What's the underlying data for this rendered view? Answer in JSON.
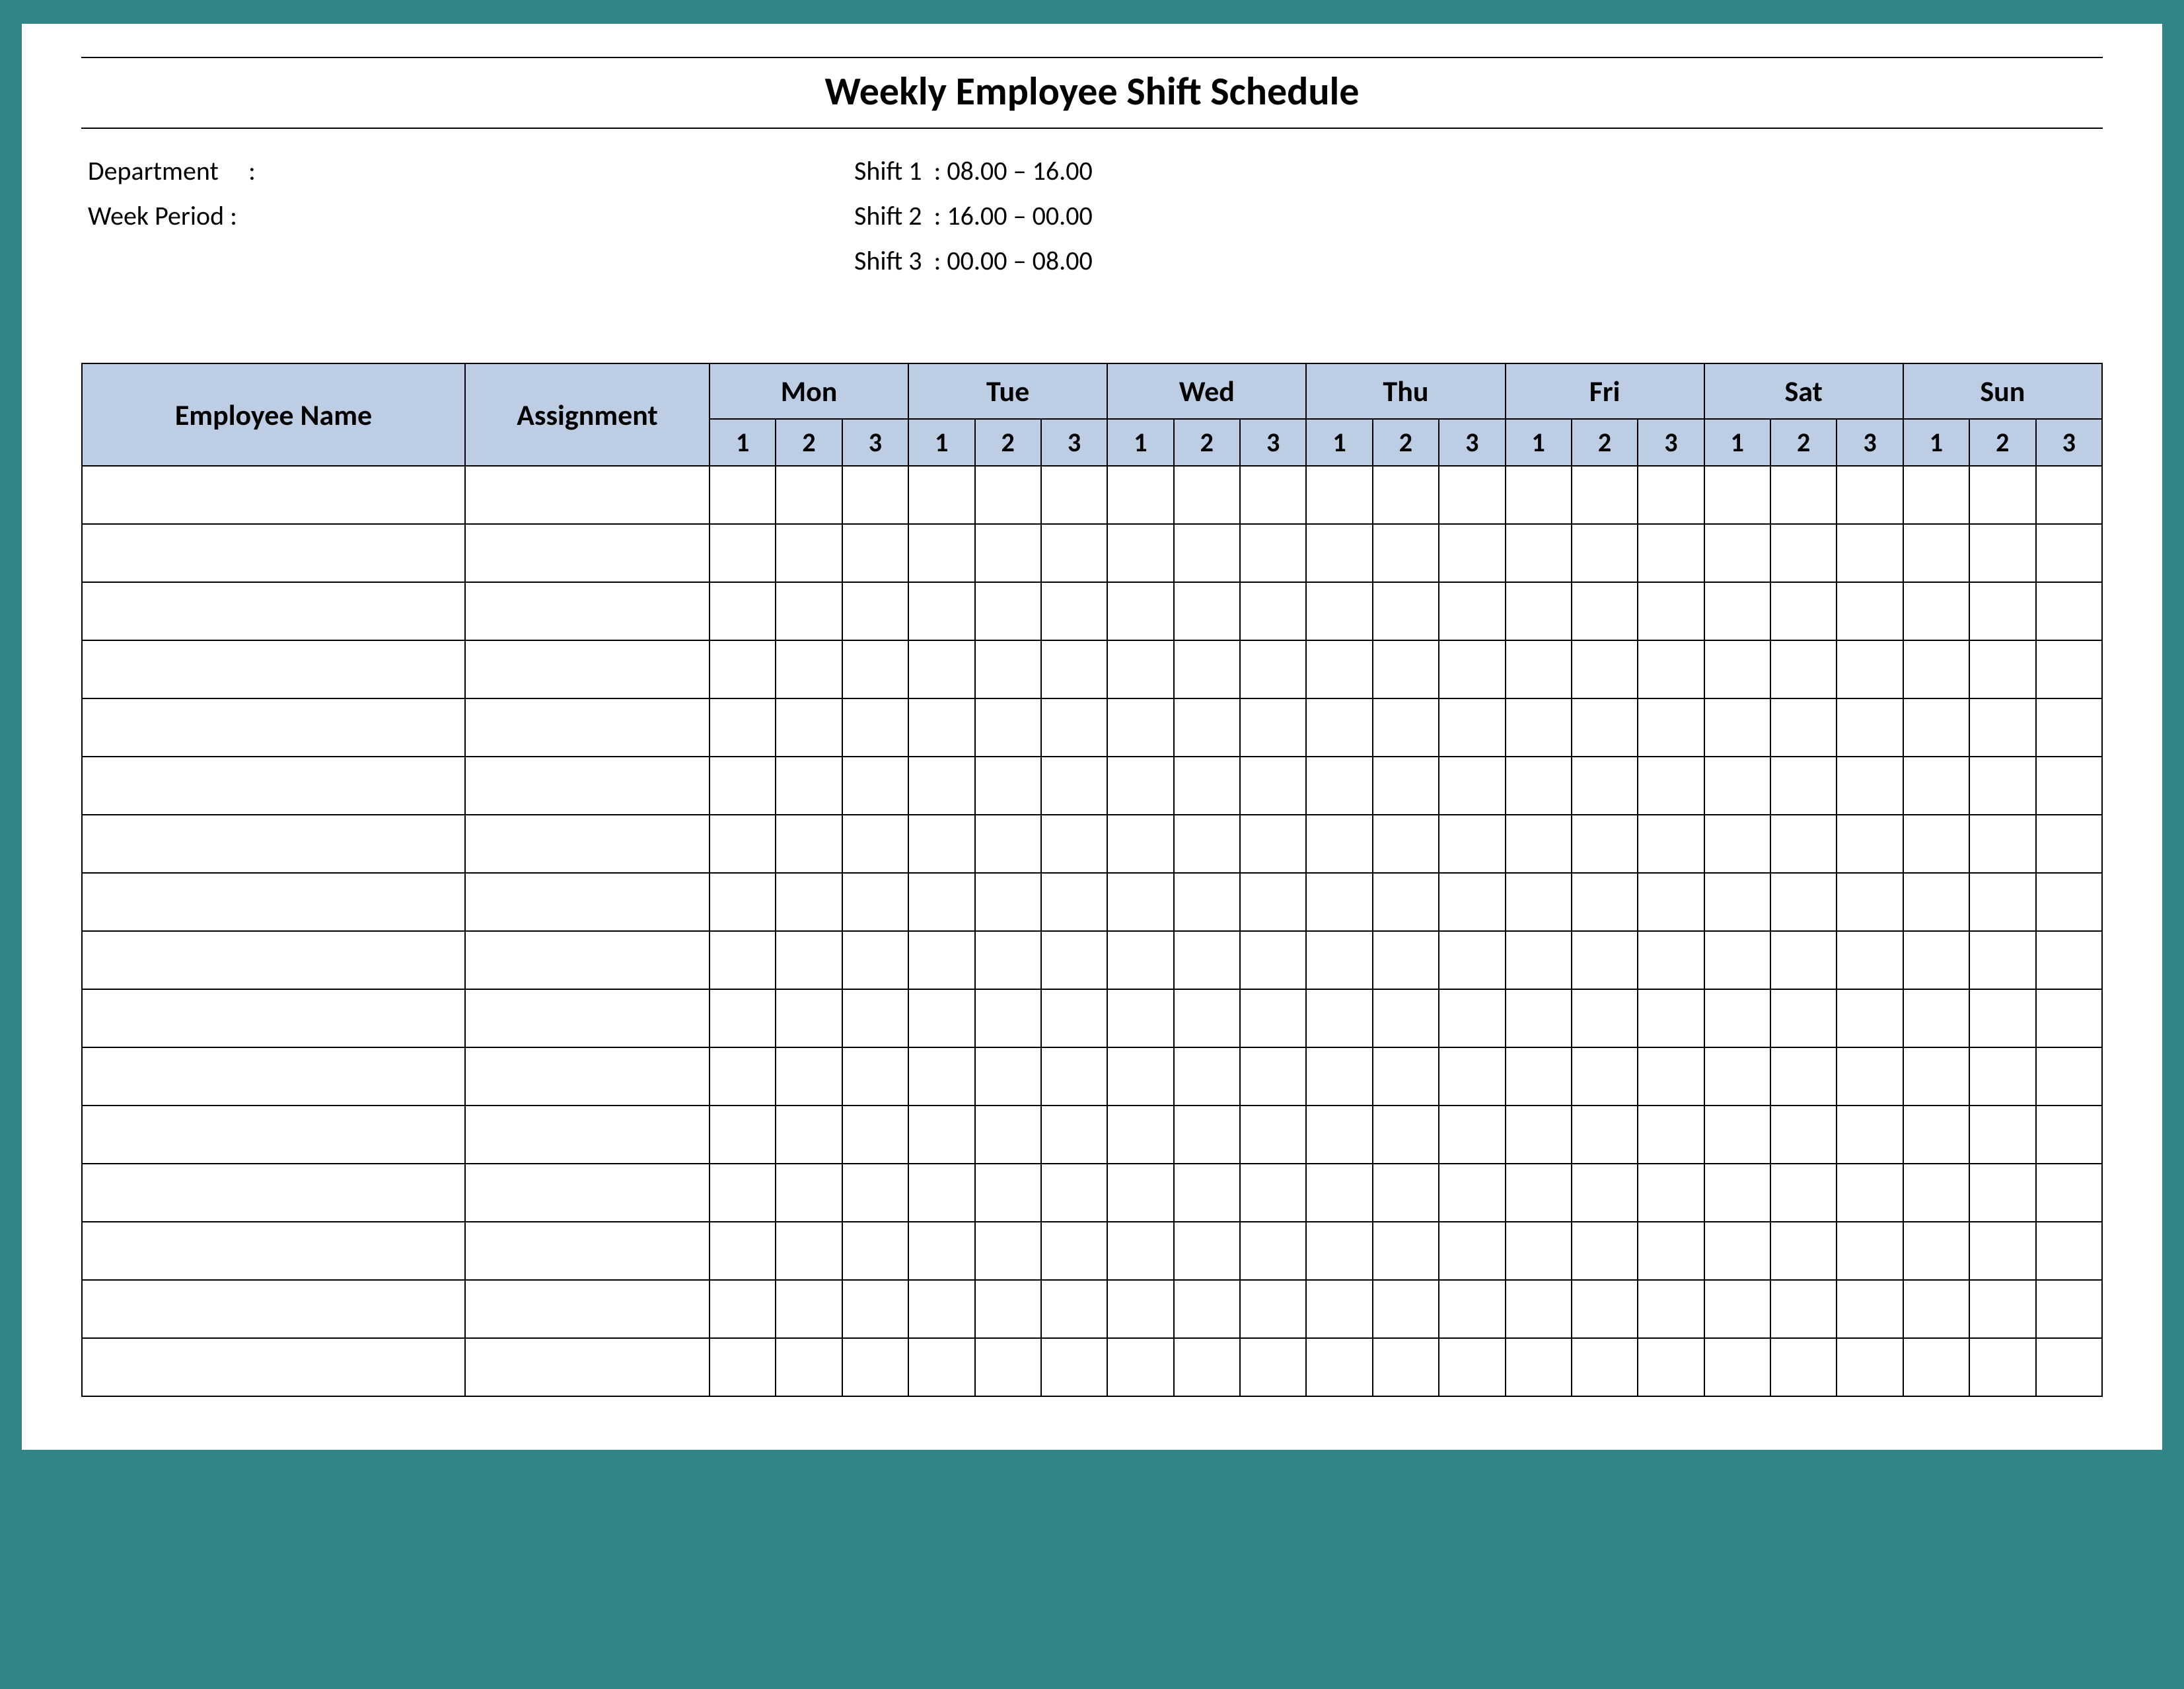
{
  "title": "Weekly Employee Shift Schedule",
  "labels": {
    "department": "Department",
    "week_period": "Week  Period",
    "shift1": "Shift 1",
    "shift2": "Shift 2",
    "shift3": "Shift 3",
    "colon": ":"
  },
  "shifts": {
    "s1": "08.00  – 16.00",
    "s2": "16.00  – 00.00",
    "s3": "00.00  – 08.00"
  },
  "headers": {
    "employee": "Employee Name",
    "assignment": "Assignment",
    "days": [
      "Mon",
      "Tue",
      "Wed",
      "Thu",
      "Fri",
      "Sat",
      "Sun"
    ],
    "subs": [
      "1",
      "2",
      "3"
    ]
  },
  "row_count": 16
}
